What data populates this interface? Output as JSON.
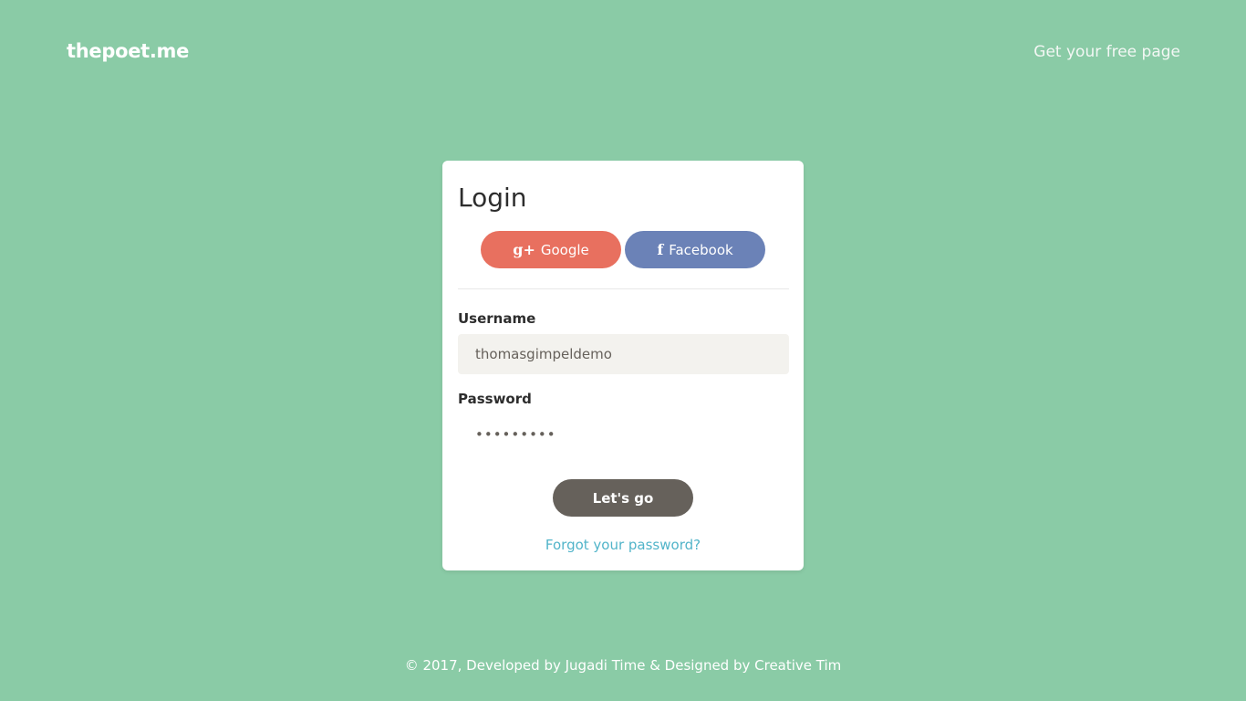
{
  "header": {
    "brand": "thepoet.me",
    "nav_link": "Get your free page"
  },
  "login": {
    "title": "Login",
    "google_label": "Google",
    "google_icon": "g+",
    "facebook_label": "Facebook",
    "facebook_icon": "f",
    "username_label": "Username",
    "username_value": "thomasgimpeldemo",
    "password_label": "Password",
    "password_value": "•••••••••",
    "submit_label": "Let's go",
    "forgot_label": "Forgot your password?"
  },
  "footer": {
    "text": "© 2017, Developed by Jugadi Time & Designed by Creative Tim"
  },
  "colors": {
    "background": "#8acba6",
    "google": "#e8705f",
    "facebook": "#6b82b7",
    "submit": "#66615b",
    "link": "#51b4c9"
  }
}
